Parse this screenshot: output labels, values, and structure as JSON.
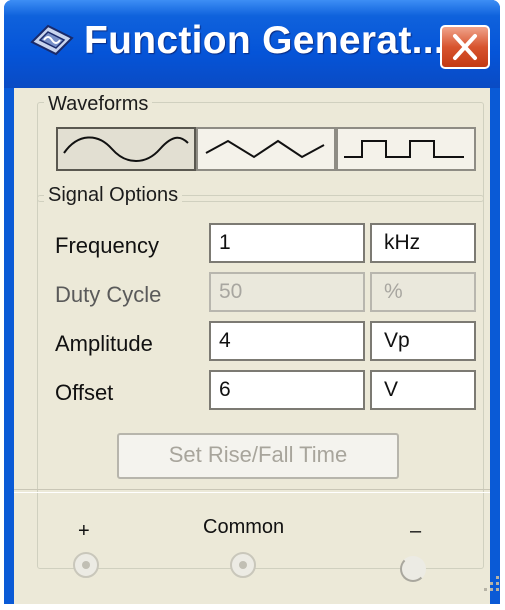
{
  "window": {
    "title": "Function Generat..."
  },
  "waveforms": {
    "group_label": "Waveforms",
    "buttons": [
      {
        "name": "sine",
        "pressed": true
      },
      {
        "name": "triangle",
        "pressed": false
      },
      {
        "name": "square",
        "pressed": false
      }
    ]
  },
  "signal_options": {
    "group_label": "Signal Options",
    "frequency": {
      "label": "Frequency",
      "value": "1",
      "unit": "kHz"
    },
    "duty_cycle": {
      "label": "Duty Cycle",
      "value": "50",
      "unit": "%",
      "enabled": false
    },
    "amplitude": {
      "label": "Amplitude",
      "value": "4",
      "unit": "Vp"
    },
    "offset": {
      "label": "Offset",
      "value": "6",
      "unit": "V"
    },
    "rise_fall_button": "Set Rise/Fall Time"
  },
  "terminals": {
    "plus": "+",
    "common": "Common",
    "minus": "–"
  },
  "colors": {
    "title_bar": "#0554d8",
    "close": "#d8542e",
    "face": "#ece9d8"
  }
}
